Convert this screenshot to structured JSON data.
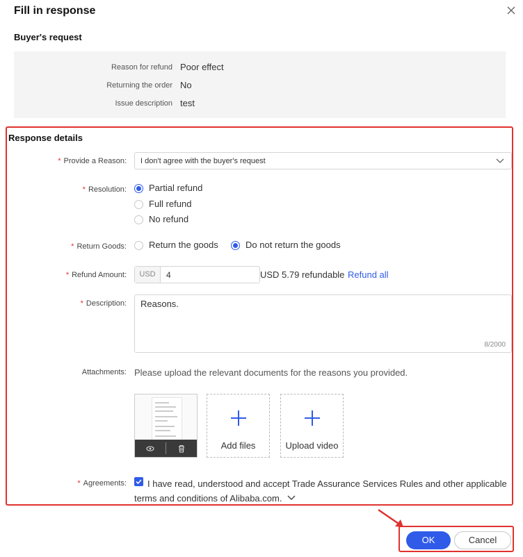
{
  "dialog": {
    "title": "Fill in response",
    "close_icon": "close-icon"
  },
  "buyer_request": {
    "heading": "Buyer's request",
    "rows": [
      {
        "label": "Reason for refund",
        "value": "Poor effect"
      },
      {
        "label": "Returning the order",
        "value": "No"
      },
      {
        "label": "Issue description",
        "value": "test"
      }
    ]
  },
  "response": {
    "heading": "Response details",
    "reason": {
      "label": "Provide a Reason:",
      "selected": "I don't agree with the buyer's request"
    },
    "resolution": {
      "label": "Resolution:",
      "options": [
        {
          "label": "Partial refund",
          "checked": true
        },
        {
          "label": "Full refund",
          "checked": false
        },
        {
          "label": "No refund",
          "checked": false
        }
      ]
    },
    "return_goods": {
      "label": "Return Goods:",
      "options": [
        {
          "label": "Return the goods",
          "checked": false
        },
        {
          "label": "Do not return the goods",
          "checked": true
        }
      ]
    },
    "refund_amount": {
      "label": "Refund Amount:",
      "currency": "USD",
      "value": "4",
      "refundable": "USD 5.79 refundable",
      "refund_all": "Refund all"
    },
    "description": {
      "label": "Description:",
      "value": "Reasons.",
      "counter": "8/2000"
    },
    "attachments": {
      "label": "Attachments:",
      "hint": "Please upload the relevant documents for the reasons you provided.",
      "add_files": "Add files",
      "upload_video": "Upload video"
    },
    "agreements": {
      "label": "Agreements:",
      "text_line1": "I have read, understood and accept Trade Assurance Services Rules and other applicable",
      "text_line2": "terms and conditions of Alibaba.com."
    }
  },
  "footer": {
    "ok_label": "OK",
    "cancel_label": "Cancel"
  },
  "colors": {
    "accent": "#2f5be8",
    "highlight": "#e0312e",
    "required": "#e0312e"
  }
}
